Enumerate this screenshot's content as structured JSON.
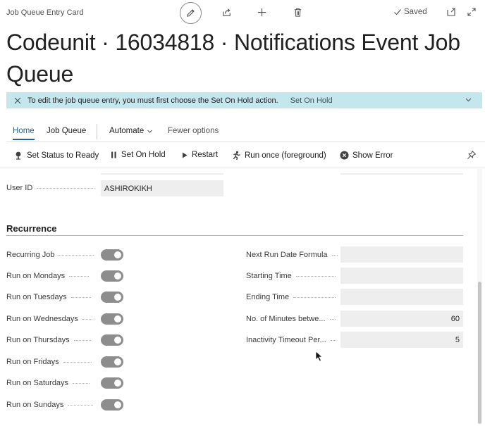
{
  "header": {
    "page_kind": "Job Queue Entry Card",
    "saved_label": "Saved",
    "title": "Codeunit · 16034818 · Notifications Event Job Queue"
  },
  "notice": {
    "message": "To edit the job queue entry, you must first choose the Set On Hold action.",
    "action": "Set On Hold"
  },
  "tabs": {
    "home": "Home",
    "job_queue": "Job Queue",
    "automate": "Automate",
    "fewer_options": "Fewer options"
  },
  "actions": {
    "set_status_ready": "Set Status to Ready",
    "set_on_hold": "Set On Hold",
    "restart": "Restart",
    "run_once": "Run once (foreground)",
    "show_error": "Show Error"
  },
  "general": {
    "user_id_label": "User ID",
    "user_id_value": "ASHIROKIKH"
  },
  "recurrence": {
    "section_title": "Recurrence",
    "toggles": [
      {
        "label": "Recurring Job",
        "value": true
      },
      {
        "label": "Run on Mondays",
        "value": true
      },
      {
        "label": "Run on Tuesdays",
        "value": true
      },
      {
        "label": "Run on Wednesdays",
        "value": true
      },
      {
        "label": "Run on Thursdays",
        "value": true
      },
      {
        "label": "Run on Fridays",
        "value": true
      },
      {
        "label": "Run on Saturdays",
        "value": true
      },
      {
        "label": "Run on Sundays",
        "value": true
      }
    ],
    "fields": [
      {
        "label": "Next Run Date Formula",
        "value": ""
      },
      {
        "label": "Starting Time",
        "value": ""
      },
      {
        "label": "Ending Time",
        "value": ""
      },
      {
        "label": "No. of Minutes betwe...",
        "value": "60"
      },
      {
        "label": "Inactivity Timeout Per...",
        "value": "5"
      }
    ]
  },
  "icons": {
    "edit": "pencil-icon",
    "share": "share-icon",
    "new": "plus-icon",
    "delete": "trash-icon",
    "open_new_window": "open-in-new-window-icon",
    "expand": "expand-icon",
    "pin": "pin-icon"
  },
  "colors": {
    "accent": "#1b5f9c",
    "notice_background": "#c4e7ee",
    "toggle_on": "#8d8d8d"
  }
}
